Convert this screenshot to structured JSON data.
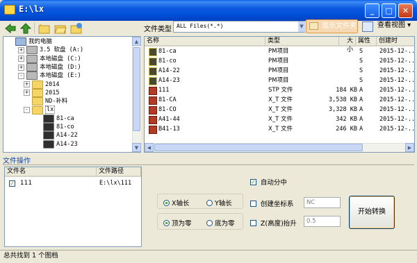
{
  "window": {
    "title": "E:\\lx",
    "minimize": "_",
    "maximize": "□",
    "close": "✕"
  },
  "toolbar": {
    "filter_label": "文件类型",
    "filter_value": "ALL Files(*.*)",
    "show_folder_label": "显示文件夹",
    "view_label": "查看视图 ▾"
  },
  "tree": {
    "items": [
      {
        "label": "我的电脑",
        "icon": "computer-icon",
        "expander": ""
      },
      {
        "label": "3.5 软盘 (A:)",
        "icon": "floppy-icon",
        "expander": "+"
      },
      {
        "label": "本地磁盘 (C:)",
        "icon": "drive-icon",
        "expander": "+"
      },
      {
        "label": "本地磁盘 (D:)",
        "icon": "drive-icon",
        "expander": "+"
      },
      {
        "label": "本地磁盘 (E:)",
        "icon": "drive-icon",
        "expander": "-"
      },
      {
        "label": "2014",
        "icon": "folder-icon",
        "expander": "+"
      },
      {
        "label": "2015",
        "icon": "folder-icon",
        "expander": "+"
      },
      {
        "label": "ND-补料",
        "icon": "folder-icon",
        "expander": ""
      },
      {
        "label": "lx",
        "icon": "folder-open-icon",
        "expander": "-"
      },
      {
        "label": "81-ca",
        "icon": "part-icon",
        "expander": ""
      },
      {
        "label": "81-co",
        "icon": "part-icon",
        "expander": ""
      },
      {
        "label": "A14-22",
        "icon": "part-icon",
        "expander": ""
      },
      {
        "label": "A14-23",
        "icon": "part-icon",
        "expander": ""
      }
    ],
    "scroll_up": "▲",
    "scroll_down": "▼"
  },
  "files": {
    "columns": [
      "名称",
      "类型",
      "大小",
      "属性",
      "创建时"
    ],
    "rows": [
      {
        "name": "81-ca",
        "type": "PM项目",
        "size": "",
        "attr": "S",
        "created": "2015-12-..",
        "icon": "pm-icon"
      },
      {
        "name": "81-co",
        "type": "PM项目",
        "size": "",
        "attr": "S",
        "created": "2015-12-..",
        "icon": "pm-icon"
      },
      {
        "name": "A14-22",
        "type": "PM项目",
        "size": "",
        "attr": "S",
        "created": "2015-12-..",
        "icon": "pm-icon"
      },
      {
        "name": "A14-23",
        "type": "PM项目",
        "size": "",
        "attr": "S",
        "created": "2015-12-..",
        "icon": "pm-icon"
      },
      {
        "name": "111",
        "type": "STP 文件",
        "size": "184 KB",
        "attr": "A",
        "created": "2015-12-..",
        "icon": "stp-icon"
      },
      {
        "name": "81-CA",
        "type": "X_T 文件",
        "size": "3,538 KB",
        "attr": "A",
        "created": "2015-12-..",
        "icon": "stp-icon"
      },
      {
        "name": "81-CO",
        "type": "X_T 文件",
        "size": "3,328 KB",
        "attr": "A",
        "created": "2015-12-..",
        "icon": "stp-icon"
      },
      {
        "name": "A41-44",
        "type": "X_T 文件",
        "size": "342 KB",
        "attr": "A",
        "created": "2015-12-..",
        "icon": "stp-icon"
      },
      {
        "name": "B41-13",
        "type": "X_T 文件",
        "size": "246 KB",
        "attr": "A",
        "created": "2015-12-..",
        "icon": "stp-icon"
      }
    ],
    "scroll_left": "◀",
    "scroll_right": "▶"
  },
  "operations": {
    "section_label": "文件操作",
    "list_columns": [
      "文件名",
      "文件路径"
    ],
    "list_rows": [
      {
        "name": "111",
        "path": "E:\\lx\\111",
        "checked": true
      }
    ],
    "auto_split": {
      "label": "自动分中",
      "checked": true
    },
    "axis_x": {
      "label": "X轴长",
      "selected": true
    },
    "axis_y": {
      "label": "Y轴长",
      "selected": false
    },
    "top_zero": {
      "label": "顶为零",
      "selected": true
    },
    "bottom_zero": {
      "label": "底为零",
      "selected": false
    },
    "create_coord": {
      "label": "创建坐标系",
      "checked": false,
      "value": "NC"
    },
    "z_raise": {
      "label": "Z(高度)抬升",
      "checked": false,
      "value": "0.5"
    },
    "convert_button": "开始转换"
  },
  "status": {
    "text": "总共找到 1 个图档"
  }
}
